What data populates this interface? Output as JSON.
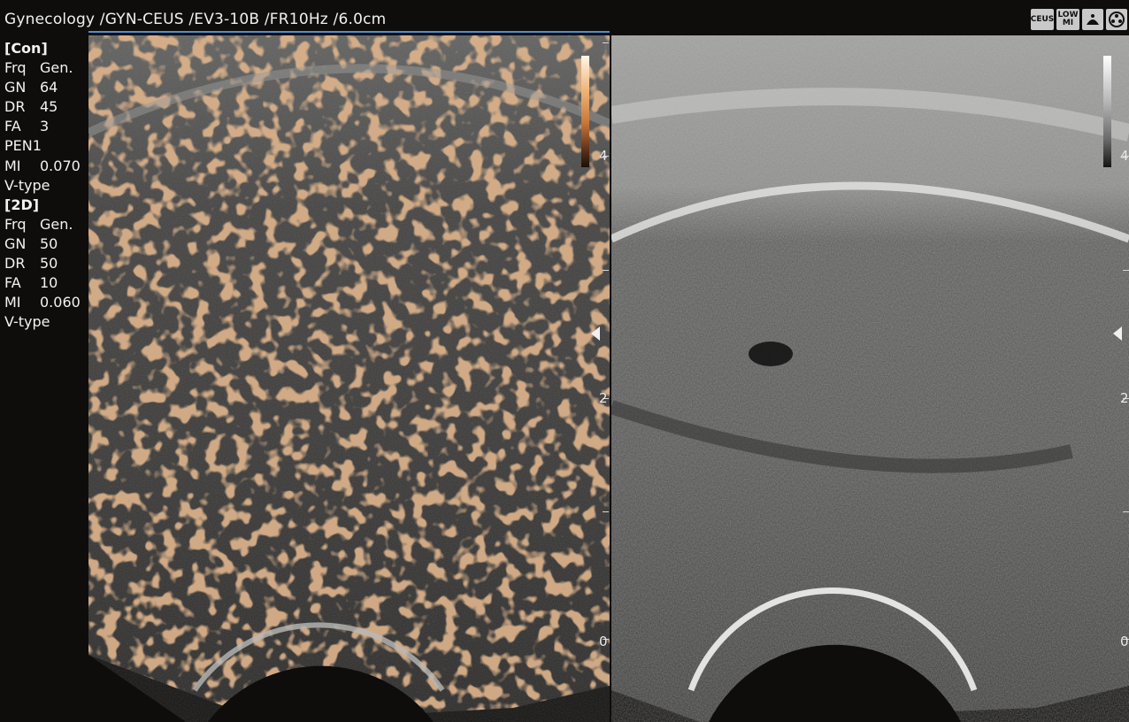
{
  "header": {
    "title": "Gynecology /GYN-CEUS /EV3-10B /FR10Hz /6.0cm",
    "icons": [
      {
        "name": "ceus-mode-icon",
        "label": "CEUS"
      },
      {
        "name": "low-mi-icon",
        "label_top": "LOW",
        "label_bottom": "MI"
      },
      {
        "name": "probe-icon"
      },
      {
        "name": "wheel-icon"
      }
    ]
  },
  "params": {
    "con": {
      "title": "[Con]",
      "frq": {
        "key": "Frq",
        "value": "Gen."
      },
      "gn": {
        "key": "GN",
        "value": "64"
      },
      "dr": {
        "key": "DR",
        "value": "45"
      },
      "fa": {
        "key": "FA",
        "value": "3"
      },
      "pen": "PEN1",
      "mi": {
        "key": "MI",
        "value": "0.070"
      },
      "vtype": "V-type"
    },
    "d2": {
      "title": "[2D]",
      "frq": {
        "key": "Frq",
        "value": "Gen."
      },
      "gn": {
        "key": "GN",
        "value": "50"
      },
      "dr": {
        "key": "DR",
        "value": "50"
      },
      "fa": {
        "key": "FA",
        "value": "10"
      },
      "mi": {
        "key": "MI",
        "value": "0.060"
      },
      "vtype": "V-type"
    }
  },
  "depth_scale": {
    "left": [
      "4",
      "2",
      "0"
    ],
    "right": [
      "4",
      "2",
      "0"
    ]
  },
  "colors": {
    "accent_underline": "#4d8fd6",
    "contrast_map": "#c9773a",
    "background": "#0e0d0c"
  }
}
